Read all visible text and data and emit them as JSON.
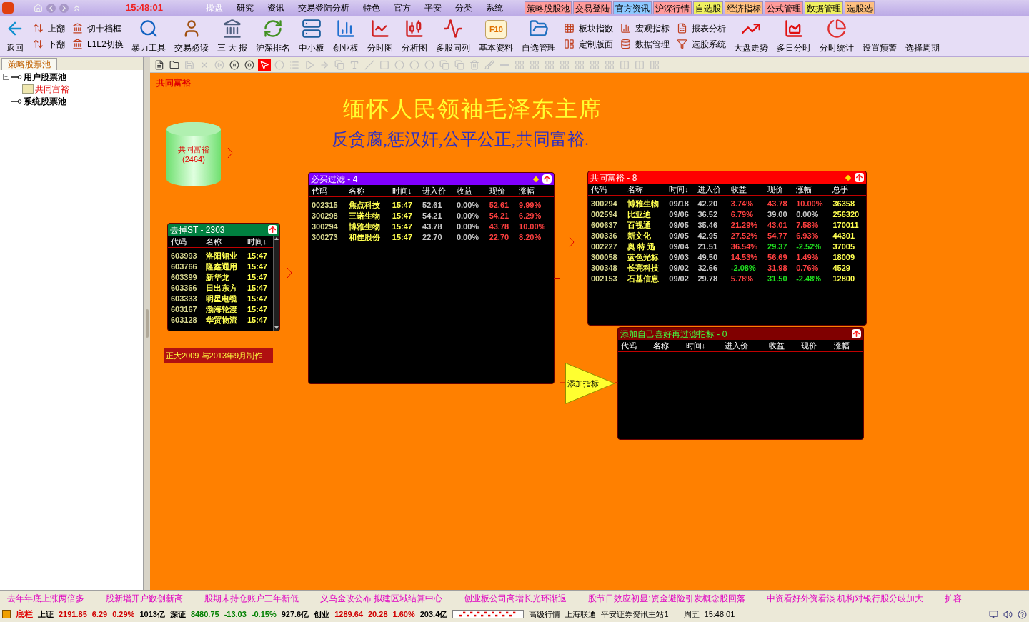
{
  "top": {
    "clock": "15:48:01"
  },
  "menu": [
    {
      "label": "操盘",
      "selected": true
    },
    {
      "label": "研究",
      "selected": false
    },
    {
      "label": "资讯",
      "selected": false
    },
    {
      "label": "交易登陆分析",
      "selected": false
    },
    {
      "label": "特色",
      "selected": false
    },
    {
      "label": "官方",
      "selected": false
    },
    {
      "label": "平安",
      "selected": false
    },
    {
      "label": "分类",
      "selected": false
    },
    {
      "label": "系统",
      "selected": false
    }
  ],
  "quick_tabs": [
    {
      "label": "策略股股池",
      "color": "#ff9a9a"
    },
    {
      "label": "交易登陆",
      "color": "#ff9a9a"
    },
    {
      "label": "官方资讯",
      "color": "#8cc8ff"
    },
    {
      "label": "沪深行情",
      "color": "#ff9a9a"
    },
    {
      "label": "自选股",
      "color": "#f0f060"
    },
    {
      "label": "经济指标",
      "color": "#ffc080"
    },
    {
      "label": "公式管理",
      "color": "#ff9a9a"
    },
    {
      "label": "数据管理",
      "color": "#f0f060"
    },
    {
      "label": "选股选",
      "color": "#ffc080"
    }
  ],
  "toolbar": [
    {
      "kind": "big",
      "label": "返回"
    },
    {
      "kind": "pair",
      "items": [
        "上翻",
        "下翻"
      ]
    },
    {
      "kind": "pair",
      "items": [
        "切十档框",
        "L1L2切换"
      ]
    },
    {
      "kind": "big",
      "label": "暴力工具"
    },
    {
      "kind": "big",
      "label": "交易必读"
    },
    {
      "kind": "big",
      "label": "三 大 报"
    },
    {
      "kind": "big",
      "label": "沪深排名"
    },
    {
      "kind": "big",
      "label": "中小板"
    },
    {
      "kind": "big",
      "label": "创业板"
    },
    {
      "kind": "big",
      "label": "分时图"
    },
    {
      "kind": "big",
      "label": "分析图"
    },
    {
      "kind": "big",
      "label": "多股同列"
    },
    {
      "kind": "big",
      "label": "基本资料",
      "badge": "F10"
    },
    {
      "kind": "big",
      "label": "自选管理"
    },
    {
      "kind": "pair",
      "items": [
        "板块指数",
        "定制版面"
      ]
    },
    {
      "kind": "pair",
      "items": [
        "宏观指标",
        "数据管理"
      ]
    },
    {
      "kind": "pair",
      "items": [
        "报表分析",
        "选股系统"
      ]
    },
    {
      "kind": "big",
      "label": "大盘走势"
    },
    {
      "kind": "big",
      "label": "多日分时"
    },
    {
      "kind": "big",
      "label": "分时统计"
    },
    {
      "kind": "big",
      "label": "设置预警"
    },
    {
      "kind": "big",
      "label": "选择周期"
    }
  ],
  "sidebar": {
    "tab": "策略股票池",
    "tree": [
      {
        "label": "用户股票池",
        "expanded": true,
        "selected": false,
        "children": [
          {
            "label": "共同富裕",
            "selected": true
          }
        ]
      },
      {
        "label": "系统股票池",
        "selected": false
      }
    ]
  },
  "draw_tools": [
    {
      "kind": "doc",
      "selected": false,
      "disabled": false
    },
    {
      "kind": "folder",
      "selected": false,
      "disabled": false
    },
    {
      "kind": "save",
      "selected": false,
      "disabled": true
    },
    {
      "kind": "delete",
      "selected": false,
      "disabled": true
    },
    {
      "kind": "play",
      "selected": false,
      "disabled": true
    },
    {
      "kind": "pause",
      "selected": false,
      "disabled": false
    },
    {
      "kind": "stop",
      "selected": false,
      "disabled": false
    },
    {
      "kind": "pointer",
      "selected": true,
      "disabled": false
    },
    {
      "kind": "circle",
      "selected": false,
      "disabled": true
    },
    {
      "kind": "list",
      "selected": false,
      "disabled": true
    },
    {
      "kind": "triangle",
      "selected": false,
      "disabled": true
    },
    {
      "kind": "arrow",
      "selected": false,
      "disabled": true
    },
    {
      "kind": "copy",
      "selected": false,
      "disabled": true
    },
    {
      "kind": "text",
      "selected": false,
      "disabled": true
    },
    {
      "kind": "line",
      "selected": false,
      "disabled": true
    },
    {
      "kind": "rect",
      "selected": false,
      "disabled": true
    },
    {
      "kind": "circle",
      "selected": false,
      "disabled": true
    },
    {
      "kind": "circle",
      "selected": false,
      "disabled": true
    },
    {
      "kind": "circle",
      "selected": false,
      "disabled": true
    },
    {
      "kind": "copy",
      "selected": false,
      "disabled": true
    },
    {
      "kind": "copy",
      "selected": false,
      "disabled": true
    },
    {
      "kind": "trash",
      "selected": false,
      "disabled": true
    },
    {
      "kind": "brush",
      "selected": false,
      "disabled": true
    },
    {
      "kind": "minus",
      "selected": false,
      "disabled": true
    },
    {
      "kind": "grid",
      "selected": false,
      "disabled": true
    },
    {
      "kind": "grid",
      "selected": false,
      "disabled": true
    },
    {
      "kind": "grid",
      "selected": false,
      "disabled": true
    },
    {
      "kind": "grid",
      "selected": false,
      "disabled": true
    },
    {
      "kind": "grid",
      "selected": false,
      "disabled": true
    },
    {
      "kind": "grid",
      "selected": false,
      "disabled": true
    },
    {
      "kind": "grid",
      "selected": false,
      "disabled": true
    },
    {
      "kind": "split",
      "selected": false,
      "disabled": true
    },
    {
      "kind": "split",
      "selected": false,
      "disabled": true
    },
    {
      "kind": "layout",
      "selected": false,
      "disabled": true
    }
  ],
  "canvas": {
    "pool_label": "共同富裕",
    "headline": "缅怀人民领袖毛泽东主席",
    "slogan": "反贪腐,惩汉奸,公平公正,共同富裕.",
    "pool_node": {
      "title": "共同富裕",
      "count": "(2464)"
    },
    "credit": "正大2009 与2013年9月制作",
    "add_node": "添加指标",
    "panels": [
      {
        "title": "去掉ST - 2303",
        "header": {
          "color": "#008040"
        },
        "diamond": false,
        "scrollbar": true,
        "columns": [
          "代码",
          "名称",
          "时间↓"
        ],
        "rows": [
          [
            "603993",
            "洛阳钼业",
            "15:47"
          ],
          [
            "603766",
            "隆鑫通用",
            "15:47"
          ],
          [
            "603399",
            "新华龙",
            "15:47"
          ],
          [
            "603366",
            "日出东方",
            "15:47"
          ],
          [
            "603333",
            "明星电缆",
            "15:47"
          ],
          [
            "603167",
            "渤海轮渡",
            "15:47"
          ],
          [
            "603128",
            "华贸物流",
            "15:47"
          ]
        ]
      },
      {
        "title": "必买过滤 - 4",
        "header": {
          "color": "#8000ff"
        },
        "diamond": true,
        "scrollbar": false,
        "columns": [
          "代码",
          "名称",
          "时间↓",
          "进入价",
          "收益",
          "现价",
          "涨幅"
        ],
        "rows": [
          [
            "002315",
            "焦点科技",
            "15:47",
            "52.61",
            "0.00%",
            {
              "text": "52.61",
              "color": "#ff4040"
            },
            {
              "text": "9.99%",
              "color": "#ff4040"
            }
          ],
          [
            "300298",
            "三诺生物",
            "15:47",
            "54.21",
            "0.00%",
            {
              "text": "54.21",
              "color": "#ff4040"
            },
            {
              "text": "6.29%",
              "color": "#ff4040"
            }
          ],
          [
            "300294",
            "博雅生物",
            "15:47",
            "43.78",
            "0.00%",
            {
              "text": "43.78",
              "color": "#ff4040"
            },
            {
              "text": "10.00%",
              "color": "#ff4040"
            }
          ],
          [
            "300273",
            "和佳股份",
            "15:47",
            "22.70",
            "0.00%",
            {
              "text": "22.70",
              "color": "#ff4040"
            },
            {
              "text": "8.20%",
              "color": "#ff4040"
            }
          ]
        ]
      },
      {
        "title": "共同富裕 - 8",
        "header": {
          "color": "#ff0000"
        },
        "diamond": true,
        "scrollbar": false,
        "columns": [
          "代码",
          "名称",
          "时间↓",
          "进入价",
          "收益",
          "现价",
          "涨幅",
          "总手"
        ],
        "rows": [
          [
            "300294",
            "博雅生物",
            "09/18",
            "42.20",
            {
              "text": "3.74%",
              "color": "#ff4040"
            },
            {
              "text": "43.78",
              "color": "#ff4040"
            },
            {
              "text": "10.00%",
              "color": "#ff4040"
            },
            "36358"
          ],
          [
            "002594",
            "比亚迪",
            "09/06",
            "36.52",
            {
              "text": "6.79%",
              "color": "#ff4040"
            },
            {
              "text": "39.00",
              "color": "#c8c8c8"
            },
            {
              "text": "0.00%",
              "color": "#c8c8c8"
            },
            "256320"
          ],
          [
            "600637",
            "百视通",
            "09/05",
            "35.46",
            {
              "text": "21.29%",
              "color": "#ff4040"
            },
            {
              "text": "43.01",
              "color": "#ff4040"
            },
            {
              "text": "7.58%",
              "color": "#ff4040"
            },
            "170011"
          ],
          [
            "300336",
            "新文化",
            "09/05",
            "42.95",
            {
              "text": "27.52%",
              "color": "#ff4040"
            },
            {
              "text": "54.77",
              "color": "#ff4040"
            },
            {
              "text": "6.93%",
              "color": "#ff4040"
            },
            "44301"
          ],
          [
            "002227",
            "奥 特 迅",
            "09/04",
            "21.51",
            {
              "text": "36.54%",
              "color": "#ff4040"
            },
            {
              "text": "29.37",
              "color": "#20e020"
            },
            {
              "text": "-2.52%",
              "color": "#20e020"
            },
            "37005"
          ],
          [
            "300058",
            "蓝色光标",
            "09/03",
            "49.50",
            {
              "text": "14.53%",
              "color": "#ff4040"
            },
            {
              "text": "56.69",
              "color": "#ff4040"
            },
            {
              "text": "1.49%",
              "color": "#ff4040"
            },
            "18009"
          ],
          [
            "300348",
            "长亮科技",
            "09/02",
            "32.66",
            {
              "text": "-2.08%",
              "color": "#20e020"
            },
            {
              "text": "31.98",
              "color": "#ff4040"
            },
            {
              "text": "0.76%",
              "color": "#ff4040"
            },
            "4529"
          ],
          [
            "002153",
            "石基信息",
            "09/02",
            "29.78",
            {
              "text": "5.78%",
              "color": "#ff4040"
            },
            {
              "text": "31.50",
              "color": "#20e020"
            },
            {
              "text": "-2.48%",
              "color": "#20e020"
            },
            "12800"
          ]
        ]
      },
      {
        "title": "添加自己喜好再过滤指标 - 0",
        "header": {
          "color": "#800000"
        },
        "diamond": false,
        "scrollbar": false,
        "columns": [
          "代码",
          "名称",
          "时间↓",
          "进入价",
          "收益",
          "现价",
          "涨幅"
        ]
      }
    ]
  },
  "ticker": [
    "去年年底上涨两倍多",
    "股新增开户数创新高",
    "股期末持仓账户三年新低",
    "义乌金改公布 拟建区域结算中心",
    "创业板公司高增长光环渐退",
    "股节日效应初显:资金避险引发概念股回落",
    "中资看好外资看淡 机构对银行股分歧加大",
    "扩容"
  ],
  "status": {
    "label": "底栏",
    "quotes": [
      {
        "text": "上证",
        "color": "#000000"
      },
      {
        "text": "2191.85",
        "color": "#d00000"
      },
      {
        "text": "6.29",
        "color": "#d00000"
      },
      {
        "text": "0.29%",
        "color": "#d00000"
      },
      {
        "text": "1013亿",
        "color": "#000000"
      },
      {
        "text": "深证",
        "color": "#000000"
      },
      {
        "text": "8480.75",
        "color": "#008000"
      },
      {
        "text": "-13.03",
        "color": "#008000"
      },
      {
        "text": "-0.15%",
        "color": "#008000"
      },
      {
        "text": "927.6亿",
        "color": "#000000"
      },
      {
        "text": "创业",
        "color": "#000000"
      },
      {
        "text": "1289.64",
        "color": "#d00000"
      },
      {
        "text": "20.28",
        "color": "#d00000"
      },
      {
        "text": "1.60%",
        "color": "#d00000"
      },
      {
        "text": "203.4亿",
        "color": "#000000"
      }
    ],
    "server": "高级行情_上海联通",
    "site": "平安证券资讯主站1",
    "weekday": "周五",
    "time": "15:48:01"
  }
}
